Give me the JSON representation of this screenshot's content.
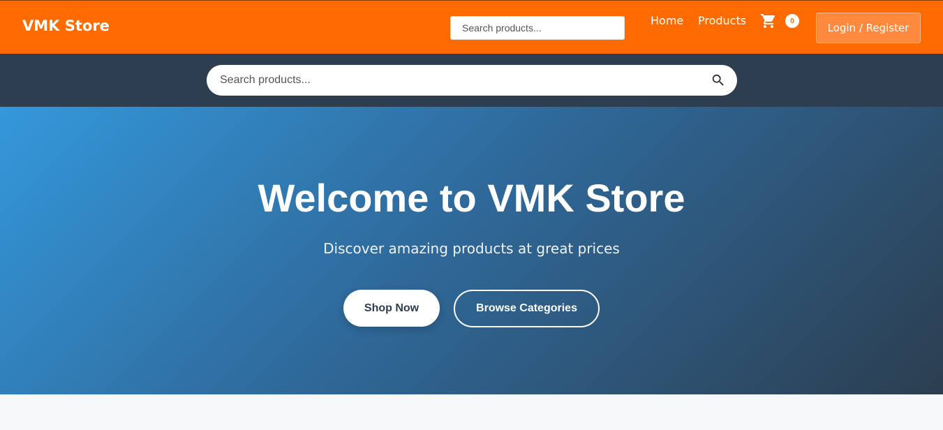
{
  "header": {
    "brand": "VMK Store",
    "search_placeholder": "Search products...",
    "nav": {
      "home": "Home",
      "products": "Products"
    },
    "cart_icon": "shopping-cart-icon",
    "cart_count": "0",
    "login_label": "Login / Register"
  },
  "search_bar": {
    "placeholder": "Search products...",
    "icon": "search-icon"
  },
  "hero": {
    "title": "Welcome to VMK Store",
    "subtitle": "Discover amazing products at great prices",
    "primary_button": "Shop Now",
    "secondary_button": "Browse Categories"
  },
  "colors": {
    "header_bg": "#ff6b00",
    "search_band_bg": "#2c3e50",
    "hero_gradient_start": "#3498db",
    "hero_gradient_end": "#2c3e50",
    "page_bg": "#f7f8fa"
  }
}
